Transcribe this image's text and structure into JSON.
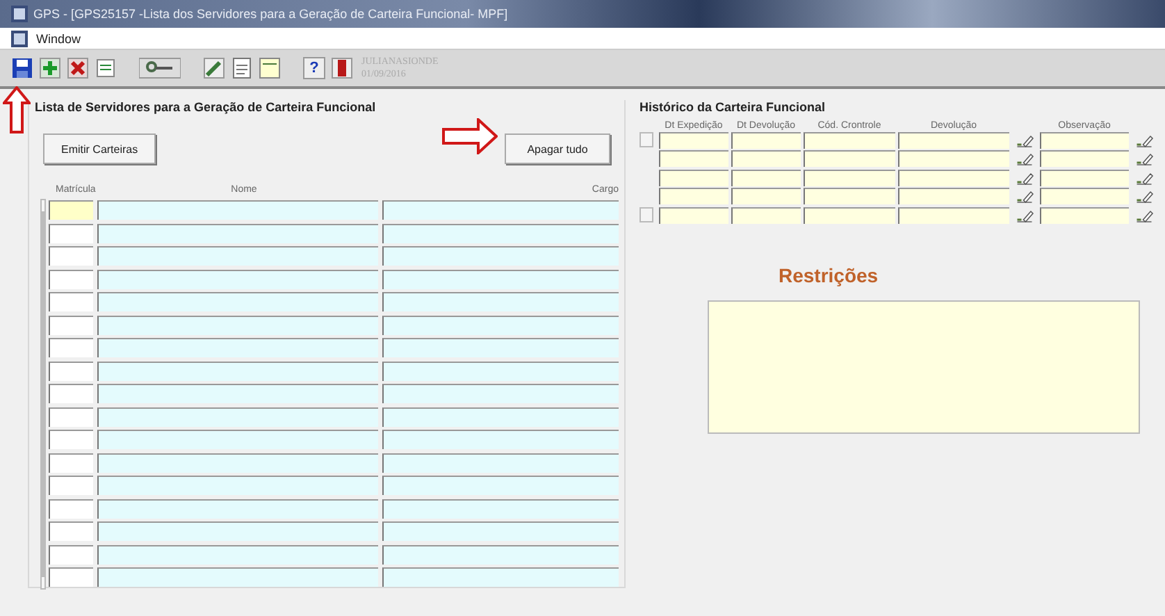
{
  "window": {
    "title": "GPS - [GPS25157 -Lista dos Servidores para a Geração de Carteira Funcional- MPF]"
  },
  "menu": [
    "Window"
  ],
  "toolbar": {
    "help_label": "?",
    "user": "JULIANASIONDE",
    "date": "01/09/2016"
  },
  "left_panel": {
    "title": "Lista de Servidores para a Geração de Carteira Funcional",
    "buttons": [
      "Emitir Carteiras",
      "Apagar tudo"
    ],
    "columns": [
      "Matrícula",
      "Nome",
      "Cargo"
    ],
    "rows": [
      {
        "selected": true
      },
      {
        "selected": false
      },
      {
        "selected": false
      },
      {
        "selected": false
      },
      {
        "selected": false
      },
      {
        "selected": false
      },
      {
        "selected": false
      },
      {
        "selected": false
      },
      {
        "selected": false
      },
      {
        "selected": false
      },
      {
        "selected": false
      },
      {
        "selected": false
      },
      {
        "selected": false
      },
      {
        "selected": false
      },
      {
        "selected": false
      },
      {
        "selected": false
      },
      {
        "selected": false
      }
    ]
  },
  "right_panel": {
    "title": "Histórico da Carteira Funcional",
    "columns": [
      "Dt Expedição",
      "Dt Devolução",
      "Cód. Crontrole",
      "Devolução",
      "Observação"
    ],
    "rows": [
      {
        "selected": false
      },
      {
        "selected": false
      },
      {
        "selected": false
      },
      {
        "selected": false
      },
      {
        "selected": false
      }
    ],
    "restrictions_label": "Restrições"
  }
}
